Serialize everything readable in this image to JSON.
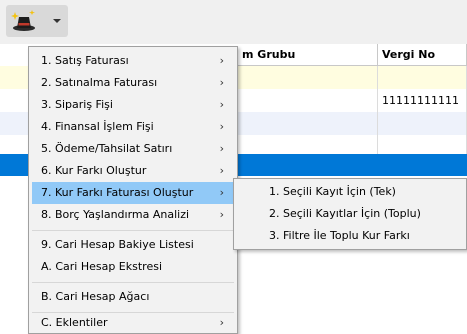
{
  "toolbar": {
    "wand_button": "magic-wand-icon"
  },
  "grid": {
    "columns": [
      "m Grubu",
      "Vergi No"
    ],
    "rows": [
      {
        "col1": "",
        "col2": ""
      },
      {
        "col1": "",
        "col2": "11111111111"
      },
      {
        "col1": "",
        "col2": ""
      },
      {
        "col1": "",
        "col2": ""
      },
      {
        "col1": "",
        "col2": ""
      }
    ]
  },
  "menu": {
    "items": [
      {
        "label": "1. Satış Faturası",
        "submenu": true
      },
      {
        "label": "2. Satınalma Faturası",
        "submenu": true
      },
      {
        "label": "3. Sipariş Fişi",
        "submenu": true
      },
      {
        "label": "4. Finansal İşlem Fişi",
        "submenu": true
      },
      {
        "label": "5. Ödeme/Tahsilat Satırı",
        "submenu": true
      },
      {
        "label": "6. Kur Farkı Oluştur",
        "submenu": true
      },
      {
        "label": "7. Kur Farkı Faturası Oluştur",
        "submenu": true,
        "active": true
      },
      {
        "label": "8. Borç Yaşlandırma Analizi",
        "submenu": true
      },
      {
        "label": "9. Cari Hesap Bakiye Listesi",
        "submenu": false
      },
      {
        "label": "A. Cari Hesap Ekstresi",
        "submenu": false
      },
      {
        "label": "B. Cari Hesap Ağacı",
        "submenu": false
      },
      {
        "label": "C. Eklentiler",
        "submenu": true
      }
    ],
    "submenu_arrow": "›"
  },
  "submenu": {
    "items": [
      {
        "label": "1. Seçili Kayıt İçin (Tek)"
      },
      {
        "label": "2. Seçili Kayıtlar İçin (Toplu)"
      },
      {
        "label": "3. Filtre İle Toplu Kur Farkı"
      }
    ]
  },
  "colors": {
    "highlight": "#91c9f7",
    "selected_row": "#0078d7",
    "row_yellow": "#fffde0",
    "row_blue_tint": "#eef2fb"
  }
}
